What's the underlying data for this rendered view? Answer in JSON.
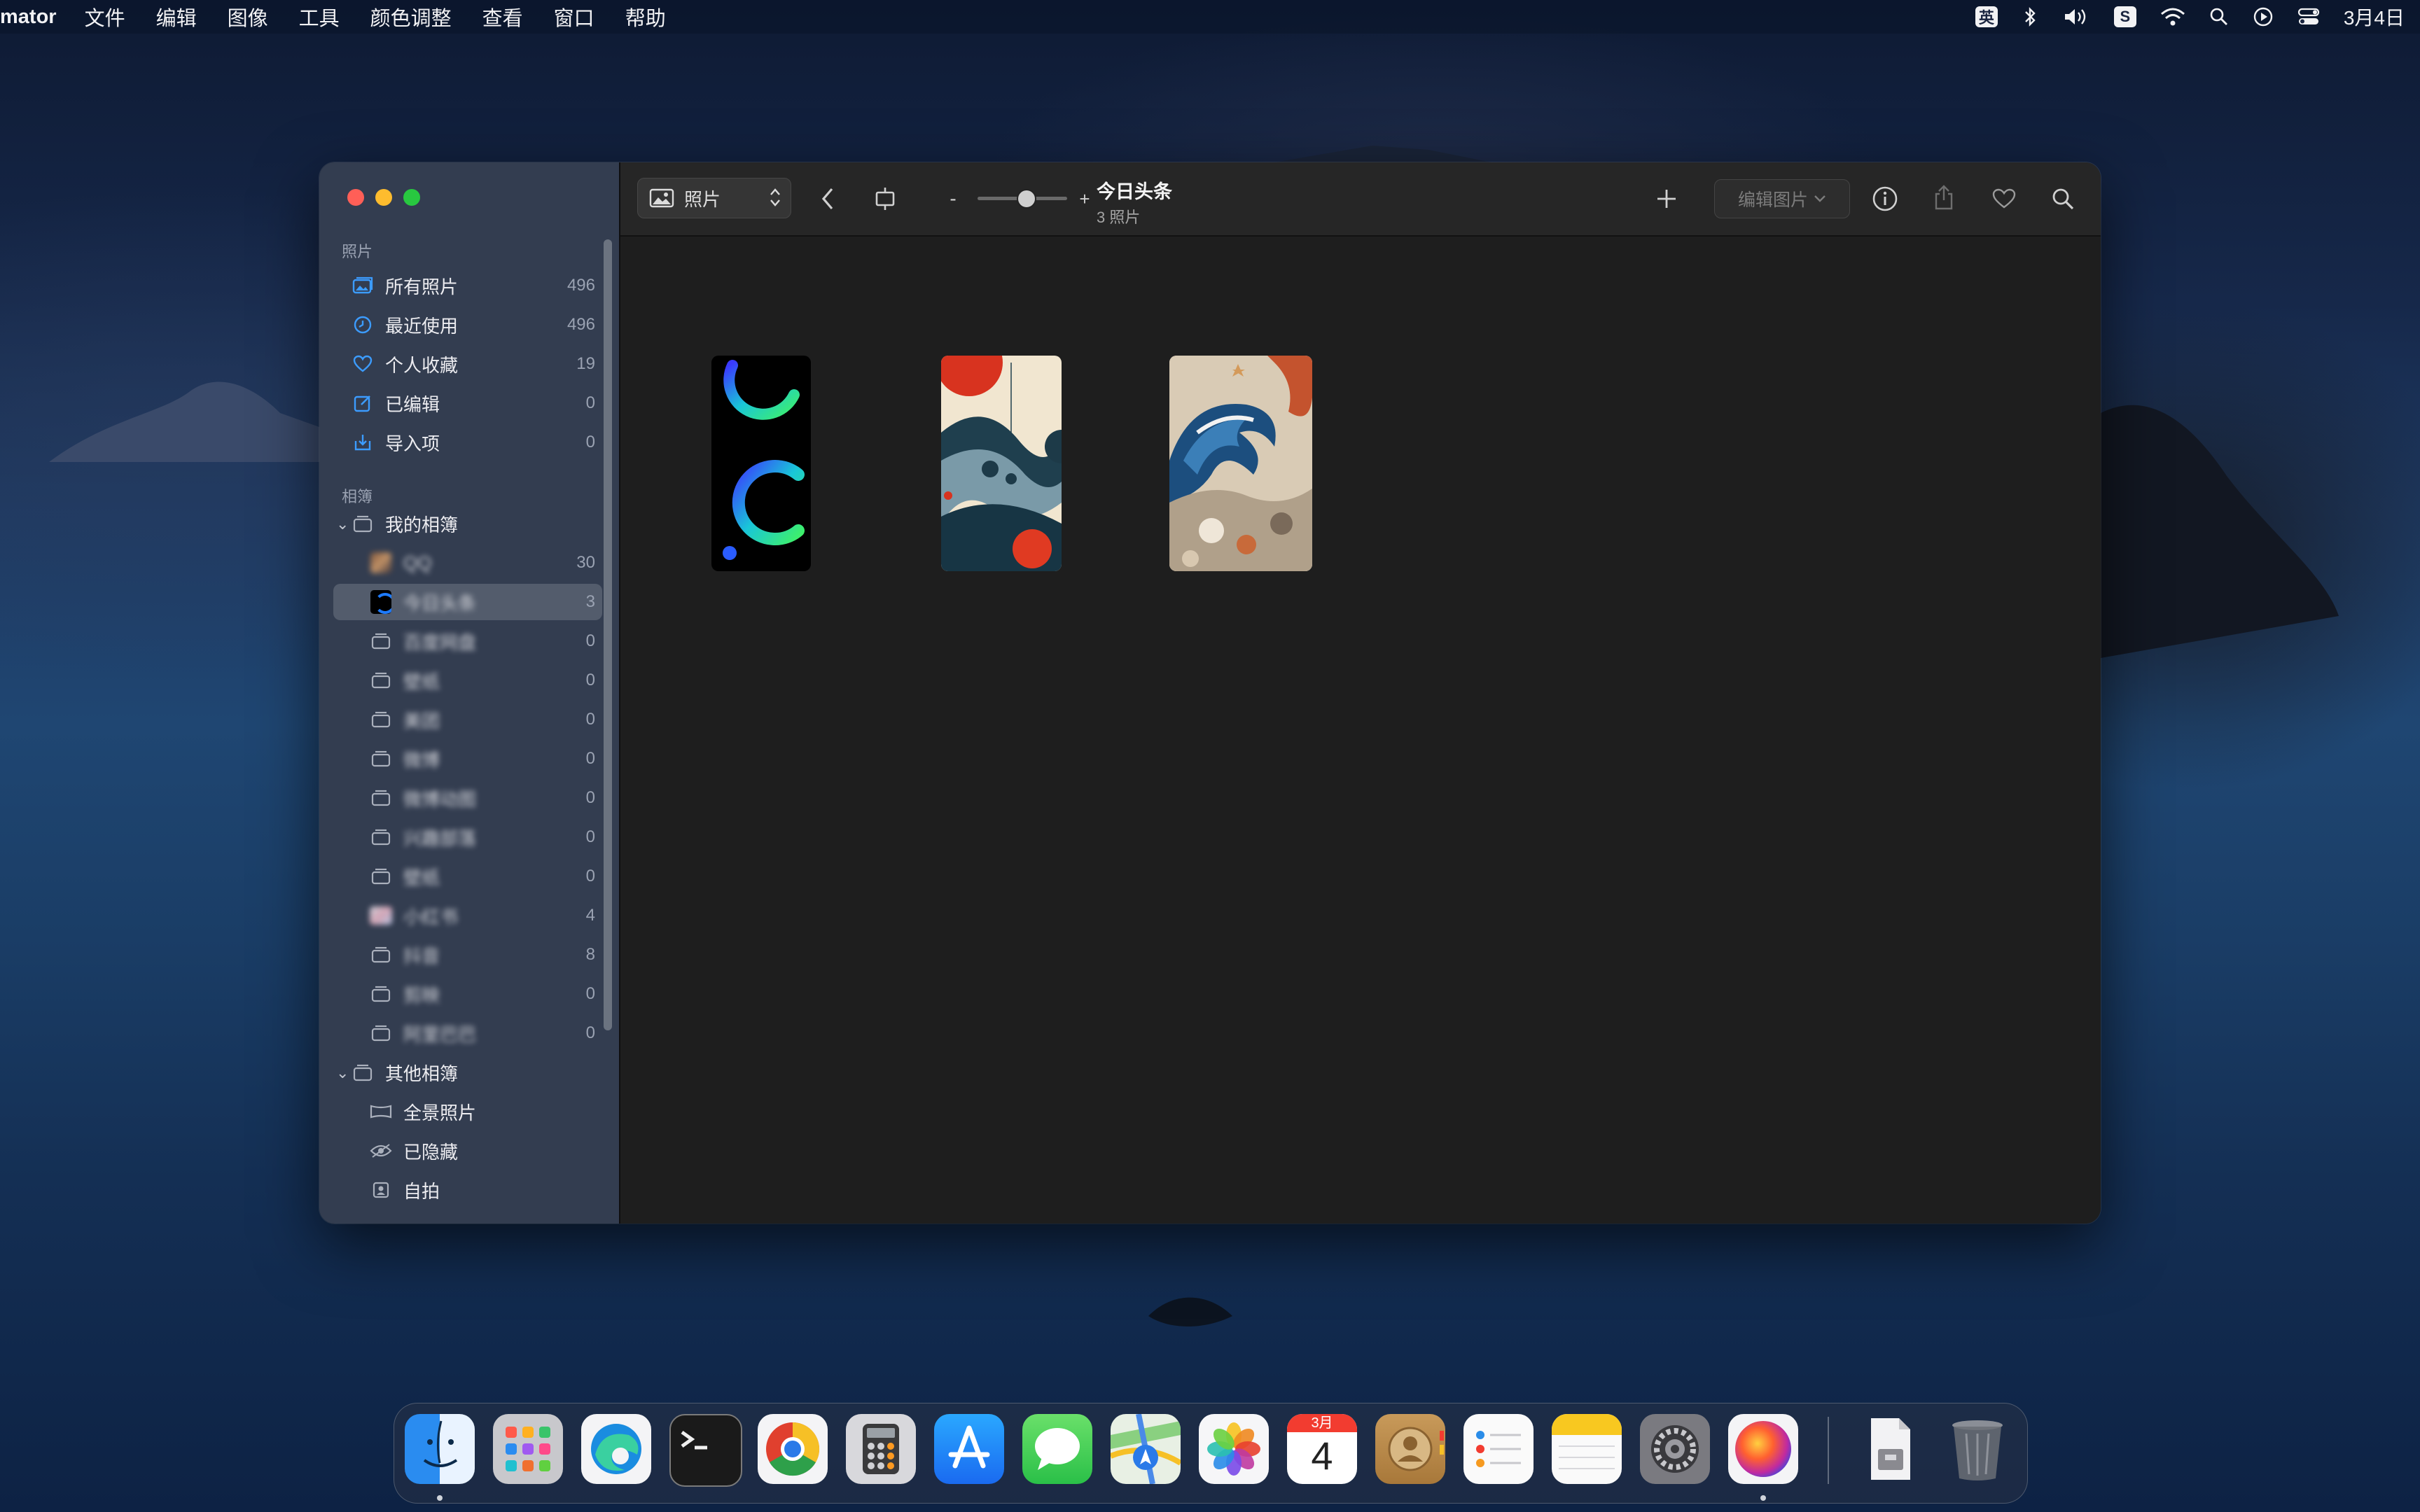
{
  "menubar": {
    "app_name": "mator",
    "items": [
      "文件",
      "编辑",
      "图像",
      "工具",
      "颜色调整",
      "查看",
      "窗口",
      "帮助"
    ],
    "input_method": "英",
    "date": "3月4日"
  },
  "sidebar": {
    "section_photos": "照片",
    "library": [
      {
        "label": "所有照片",
        "count": "496",
        "icon": "photo-library-icon"
      },
      {
        "label": "最近使用",
        "count": "496",
        "icon": "clock-icon"
      },
      {
        "label": "个人收藏",
        "count": "19",
        "icon": "heart-icon"
      },
      {
        "label": "已编辑",
        "count": "0",
        "icon": "edit-icon"
      },
      {
        "label": "导入项",
        "count": "0",
        "icon": "import-icon"
      }
    ],
    "section_albums": "相簿",
    "my_albums_label": "我的相簿",
    "albums": [
      {
        "label": "QQ",
        "count": "30"
      },
      {
        "label": "今日头条",
        "count": "3"
      },
      {
        "label": "百度网盘",
        "count": "0"
      },
      {
        "label": "壁纸",
        "count": "0"
      },
      {
        "label": "美团",
        "count": "0"
      },
      {
        "label": "微博",
        "count": "0"
      },
      {
        "label": "微博动图",
        "count": "0"
      },
      {
        "label": "兴趣部落",
        "count": "0"
      },
      {
        "label": "壁纸",
        "count": "0"
      },
      {
        "label": "小红书",
        "count": "4"
      },
      {
        "label": "抖音",
        "count": "8"
      },
      {
        "label": "剪映",
        "count": "0"
      },
      {
        "label": "阿里巴巴",
        "count": "0"
      }
    ],
    "other_albums_label": "其他相簿",
    "other_albums": [
      {
        "label": "全景照片",
        "icon": "panorama-icon"
      },
      {
        "label": "已隐藏",
        "icon": "eye-icon"
      },
      {
        "label": "自拍",
        "icon": "selfie-icon"
      }
    ]
  },
  "toolbar": {
    "source_label": "照片",
    "zoom_minus": "-",
    "zoom_plus": "+",
    "zoom_level": 0.55,
    "album_title": "今日头条",
    "album_subtitle": "3 照片",
    "edit_button": "编辑图片"
  },
  "calendar": {
    "month": "3月",
    "day": "4"
  },
  "colors": {
    "accent": "#3c9cff",
    "selection": "#4a5468"
  }
}
